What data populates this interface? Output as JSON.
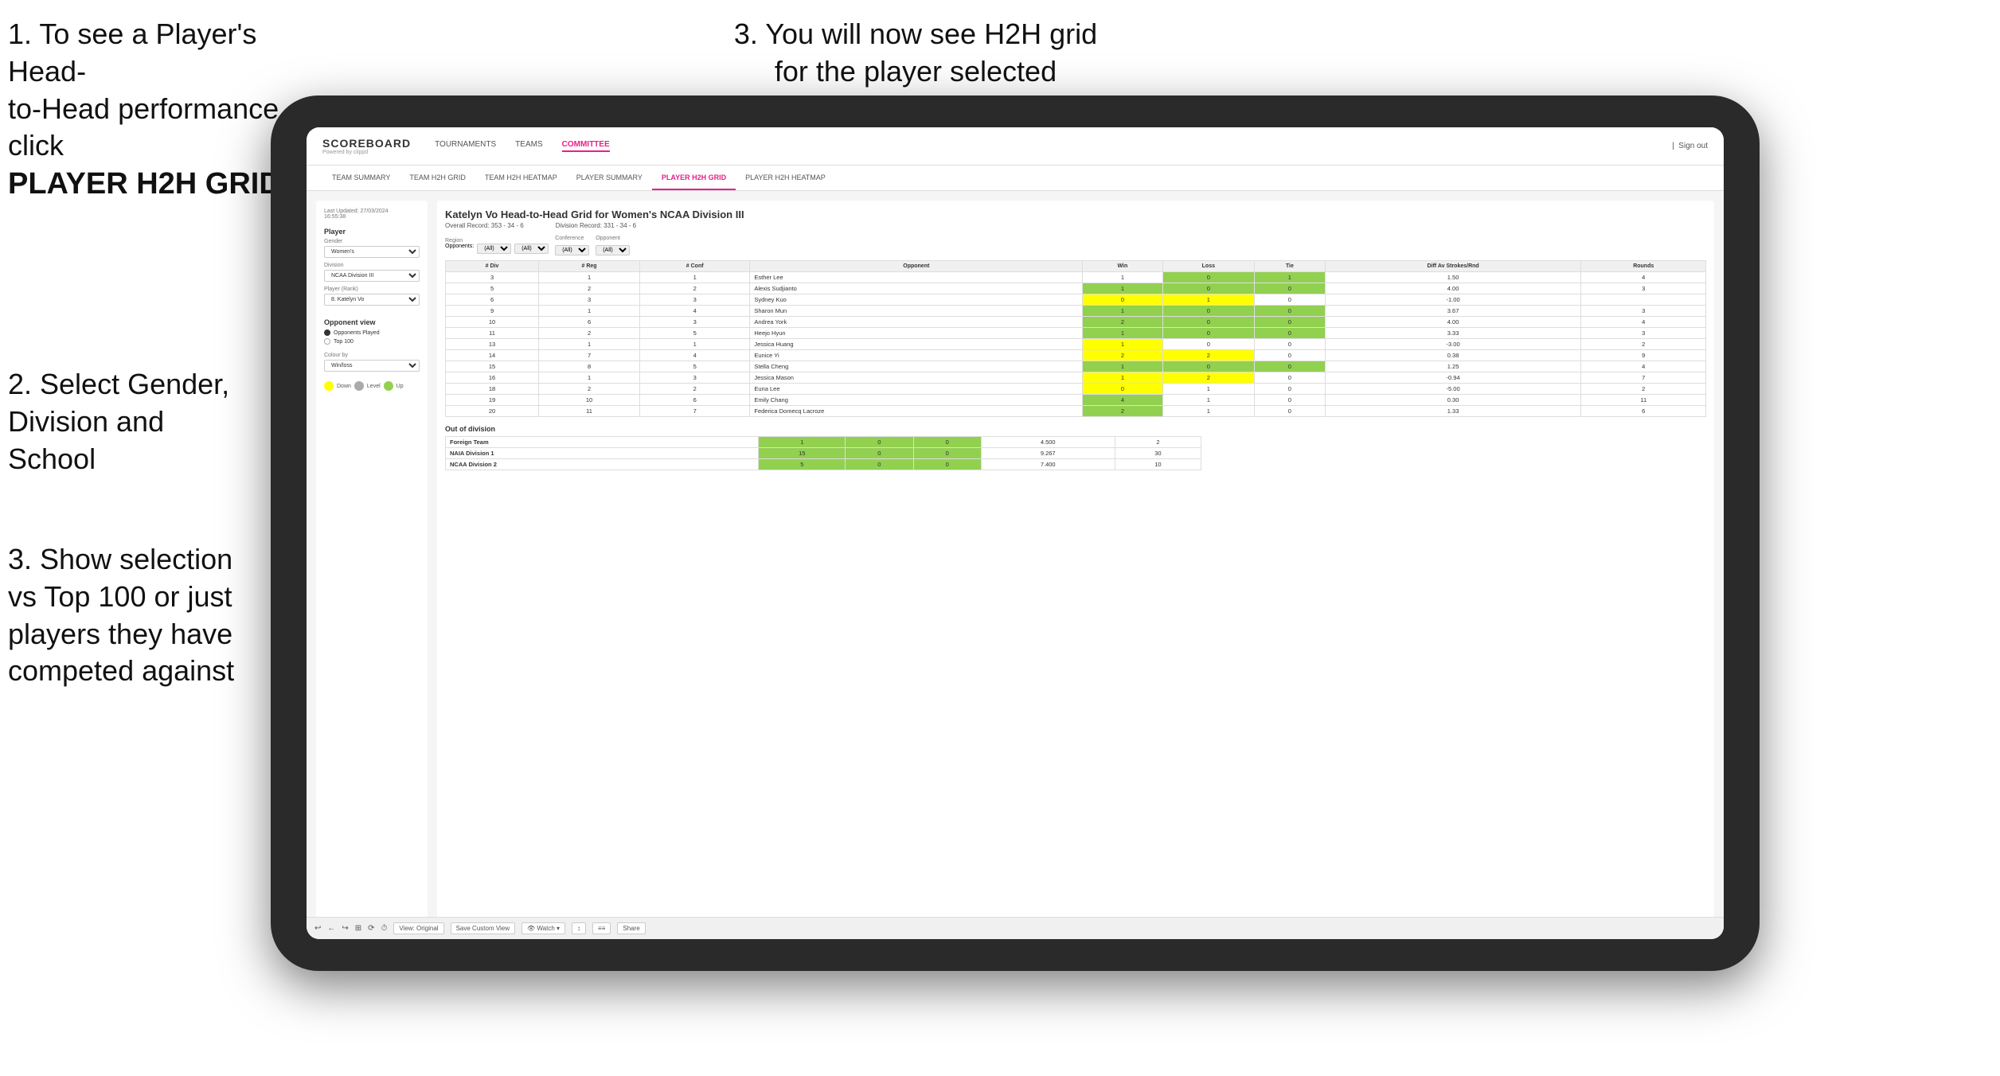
{
  "instructions": {
    "top_left_line1": "1. To see a Player's Head-",
    "top_left_line2": "to-Head performance click",
    "top_left_line3": "PLAYER H2H GRID",
    "top_right": "3. You will now see H2H grid\nfor the player selected",
    "mid_left_title": "2. Select Gender,\nDivision and\nSchool",
    "bot_left": "3. Show selection\nvs Top 100 or just\nplayers they have\ncompeted against"
  },
  "nav": {
    "logo": "SCOREBOARD",
    "logo_sub": "Powered by clippd",
    "links": [
      "TOURNAMENTS",
      "TEAMS",
      "COMMITTEE"
    ],
    "active_link": "COMMITTEE",
    "sign_out": "Sign out"
  },
  "sub_nav": {
    "links": [
      "TEAM SUMMARY",
      "TEAM H2H GRID",
      "TEAM H2H HEATMAP",
      "PLAYER SUMMARY",
      "PLAYER H2H GRID",
      "PLAYER H2H HEATMAP"
    ],
    "active": "PLAYER H2H GRID"
  },
  "sidebar": {
    "updated": "Last Updated: 27/03/2024\n16:55:38",
    "player_section": "Player",
    "gender_label": "Gender",
    "gender_value": "Women's",
    "division_label": "Division",
    "division_value": "NCAA Division III",
    "player_rank_label": "Player (Rank)",
    "player_rank_value": "8. Katelyn Vo",
    "opponent_view_title": "Opponent view",
    "radio_options": [
      "Opponents Played",
      "Top 100"
    ],
    "radio_selected": "Opponents Played",
    "colour_by_label": "Colour by",
    "colour_by_value": "Win/loss",
    "legend": [
      {
        "color": "#ffff00",
        "label": "Down"
      },
      {
        "color": "#aaaaaa",
        "label": "Level"
      },
      {
        "color": "#92d050",
        "label": "Up"
      }
    ]
  },
  "main": {
    "title": "Katelyn Vo Head-to-Head Grid for Women's NCAA Division III",
    "overall_record": "Overall Record: 353 - 34 - 6",
    "division_record": "Division Record: 331 - 34 - 6",
    "filters": {
      "opponents_label": "Opponents:",
      "opponents_value": "(All)",
      "region_label": "Region",
      "conference_label": "Conference",
      "conference_value": "(All)",
      "opponent_label": "Opponent",
      "opponent_value": "(All)"
    },
    "table_headers": [
      "#\nDiv",
      "#\nReg",
      "#\nConf",
      "Opponent",
      "Win",
      "Loss",
      "Tie",
      "Diff Av\nStrokes/Rnd",
      "Rounds"
    ],
    "rows": [
      {
        "div": "3",
        "reg": "1",
        "conf": "1",
        "opponent": "Esther Lee",
        "win": "1",
        "loss": "0",
        "tie": "1",
        "diff": "1.50",
        "rounds": "4",
        "win_color": "white",
        "loss_color": "green",
        "tie_color": "green"
      },
      {
        "div": "5",
        "reg": "2",
        "conf": "2",
        "opponent": "Alexis Sudjianto",
        "win": "1",
        "loss": "0",
        "tie": "0",
        "diff": "4.00",
        "rounds": "3",
        "win_color": "green",
        "loss_color": "green",
        "tie_color": "green"
      },
      {
        "div": "6",
        "reg": "3",
        "conf": "3",
        "opponent": "Sydney Kuo",
        "win": "0",
        "loss": "1",
        "tie": "0",
        "diff": "-1.00",
        "rounds": "",
        "win_color": "yellow",
        "loss_color": "yellow",
        "tie_color": "white"
      },
      {
        "div": "9",
        "reg": "1",
        "conf": "4",
        "opponent": "Sharon Mun",
        "win": "1",
        "loss": "0",
        "tie": "0",
        "diff": "3.67",
        "rounds": "3",
        "win_color": "green",
        "loss_color": "green",
        "tie_color": "green"
      },
      {
        "div": "10",
        "reg": "6",
        "conf": "3",
        "opponent": "Andrea York",
        "win": "2",
        "loss": "0",
        "tie": "0",
        "diff": "4.00",
        "rounds": "4",
        "win_color": "green",
        "loss_color": "green",
        "tie_color": "green"
      },
      {
        "div": "11",
        "reg": "2",
        "conf": "5",
        "opponent": "Heejo Hyun",
        "win": "1",
        "loss": "0",
        "tie": "0",
        "diff": "3.33",
        "rounds": "3",
        "win_color": "green",
        "loss_color": "green",
        "tie_color": "green"
      },
      {
        "div": "13",
        "reg": "1",
        "conf": "1",
        "opponent": "Jessica Huang",
        "win": "1",
        "loss": "0",
        "tie": "0",
        "diff": "-3.00",
        "rounds": "2",
        "win_color": "yellow",
        "loss_color": "white",
        "tie_color": "white"
      },
      {
        "div": "14",
        "reg": "7",
        "conf": "4",
        "opponent": "Eunice Yi",
        "win": "2",
        "loss": "2",
        "tie": "0",
        "diff": "0.38",
        "rounds": "9",
        "win_color": "yellow",
        "loss_color": "yellow",
        "tie_color": "white"
      },
      {
        "div": "15",
        "reg": "8",
        "conf": "5",
        "opponent": "Stella Cheng",
        "win": "1",
        "loss": "0",
        "tie": "0",
        "diff": "1.25",
        "rounds": "4",
        "win_color": "green",
        "loss_color": "green",
        "tie_color": "green"
      },
      {
        "div": "16",
        "reg": "1",
        "conf": "3",
        "opponent": "Jessica Mason",
        "win": "1",
        "loss": "2",
        "tie": "0",
        "diff": "-0.94",
        "rounds": "7",
        "win_color": "yellow",
        "loss_color": "yellow",
        "tie_color": "white"
      },
      {
        "div": "18",
        "reg": "2",
        "conf": "2",
        "opponent": "Euna Lee",
        "win": "0",
        "loss": "1",
        "tie": "0",
        "diff": "-5.00",
        "rounds": "2",
        "win_color": "yellow",
        "loss_color": "white",
        "tie_color": "white"
      },
      {
        "div": "19",
        "reg": "10",
        "conf": "6",
        "opponent": "Emily Chang",
        "win": "4",
        "loss": "1",
        "tie": "0",
        "diff": "0.30",
        "rounds": "11",
        "win_color": "green",
        "loss_color": "white",
        "tie_color": "white"
      },
      {
        "div": "20",
        "reg": "11",
        "conf": "7",
        "opponent": "Federica Domecq Lacroze",
        "win": "2",
        "loss": "1",
        "tie": "0",
        "diff": "1.33",
        "rounds": "6",
        "win_color": "green",
        "loss_color": "white",
        "tie_color": "white"
      }
    ],
    "out_of_division_title": "Out of division",
    "out_of_division_rows": [
      {
        "label": "Foreign Team",
        "win": "1",
        "loss": "0",
        "tie": "0",
        "diff": "4.500",
        "rounds": "2"
      },
      {
        "label": "NAIA Division 1",
        "win": "15",
        "loss": "0",
        "tie": "0",
        "diff": "9.267",
        "rounds": "30"
      },
      {
        "label": "NCAA Division 2",
        "win": "5",
        "loss": "0",
        "tie": "0",
        "diff": "7.400",
        "rounds": "10"
      }
    ],
    "toolbar_buttons": [
      "↩",
      "←",
      "↪",
      "⊞",
      "↩↪",
      "⏱",
      "View: Original",
      "Save Custom View",
      "👁 Watch ▾",
      "↕",
      "≡≡",
      "Share"
    ]
  }
}
